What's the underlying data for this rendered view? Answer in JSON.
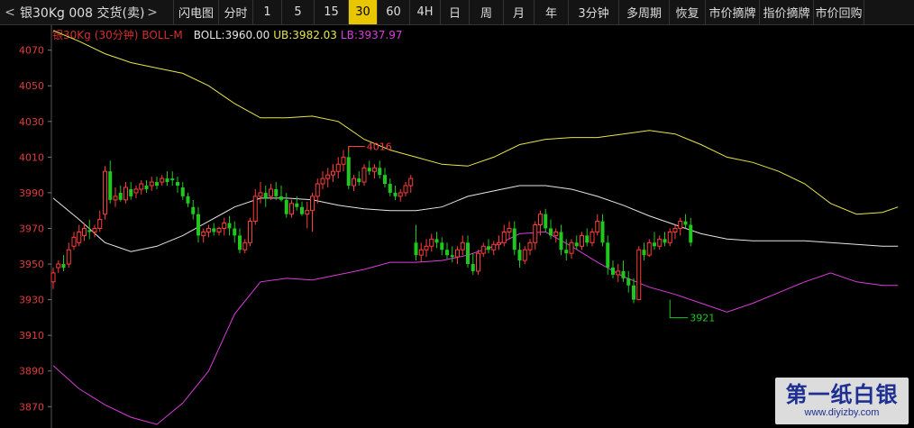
{
  "toolbar": {
    "nav_left": "<",
    "nav_right": ">",
    "title": "银30Kg 008 交货(卖)",
    "buttons": [
      {
        "label": "闪电图",
        "active": false
      },
      {
        "label": "分时",
        "active": false
      },
      {
        "label": "1",
        "active": false
      },
      {
        "label": "5",
        "active": false
      },
      {
        "label": "15",
        "active": false
      },
      {
        "label": "30",
        "active": true
      },
      {
        "label": "60",
        "active": false
      },
      {
        "label": "4H",
        "active": false
      },
      {
        "label": "日",
        "active": false
      },
      {
        "label": "周",
        "active": false
      },
      {
        "label": "月",
        "active": false
      },
      {
        "label": "年",
        "active": false
      },
      {
        "label": "3分钟",
        "active": false
      },
      {
        "label": "多周期",
        "active": false
      },
      {
        "label": "恢复",
        "active": false
      },
      {
        "label": "市价摘牌",
        "active": false
      },
      {
        "label": "指价摘牌",
        "active": false
      },
      {
        "label": "市价回购",
        "active": false
      }
    ]
  },
  "legend": {
    "instrument": "银30Kg",
    "period": "(30分钟)",
    "indicator": "BOLL-M",
    "boll": "BOLL:3960.00",
    "ub": "UB:3982.03",
    "lb": "LB:3937.97"
  },
  "colors": {
    "background": "#000000",
    "up_candle": "#ff3c3c",
    "down_candle": "#1ec81e",
    "doji": "#e6e6e6",
    "mid_band": "#e6e6e6",
    "upper_band": "#e6e64a",
    "lower_band": "#dc3cdc",
    "axis_label": "#e03c3c",
    "legend_boll": "#e6e6e6",
    "legend_ub": "#e6e64a",
    "legend_lb": "#dc3cdc",
    "legend_instrument": "#d03030",
    "accent": "#e8c700"
  },
  "watermark": {
    "name": "第一纸白银",
    "url": "www.diyizby.com"
  },
  "chart_data": {
    "type": "candlestick",
    "ylim": [
      3858,
      4084
    ],
    "yticks": [
      3870,
      3890,
      3910,
      3930,
      3950,
      3970,
      3990,
      4010,
      4030,
      4050,
      4070
    ],
    "grid": false,
    "annotations": [
      {
        "text": "4016",
        "index": 57,
        "value": 4016
      },
      {
        "text": "3921",
        "index": 119,
        "value": 3930
      }
    ],
    "ohlc": [
      [
        3940,
        3948,
        3936,
        3945
      ],
      [
        3948,
        3952,
        3945,
        3950
      ],
      [
        3950,
        3955,
        3946,
        3948
      ],
      [
        3950,
        3962,
        3948,
        3958
      ],
      [
        3960,
        3968,
        3958,
        3965
      ],
      [
        3962,
        3972,
        3960,
        3968
      ],
      [
        3966,
        3973,
        3963,
        3970
      ],
      [
        3969,
        3975,
        3964,
        3968
      ],
      [
        3968,
        3972,
        3965,
        3970
      ],
      [
        3970,
        3980,
        3968,
        3975
      ],
      [
        3978,
        4005,
        3975,
        4002
      ],
      [
        4002,
        4008,
        3984,
        3986
      ],
      [
        3986,
        3993,
        3982,
        3988
      ],
      [
        3990,
        3994,
        3985,
        3986
      ],
      [
        3986,
        3996,
        3984,
        3993
      ],
      [
        3992,
        3996,
        3986,
        3988
      ],
      [
        3990,
        3994,
        3987,
        3992
      ],
      [
        3992,
        3997,
        3989,
        3995
      ],
      [
        3994,
        3997,
        3990,
        3992
      ],
      [
        3994,
        3999,
        3991,
        3996
      ],
      [
        3996,
        3999,
        3992,
        3994
      ],
      [
        3996,
        4000,
        3994,
        3998
      ],
      [
        3998,
        4002,
        3994,
        3996
      ],
      [
        3998,
        4002,
        3994,
        3997
      ],
      [
        3996,
        3999,
        3990,
        3994
      ],
      [
        3993,
        3996,
        3986,
        3988
      ],
      [
        3988,
        3990,
        3982,
        3984
      ],
      [
        3982,
        3986,
        3975,
        3978
      ],
      [
        3978,
        3982,
        3962,
        3966
      ],
      [
        3966,
        3970,
        3962,
        3968
      ],
      [
        3968,
        3972,
        3965,
        3970
      ],
      [
        3970,
        3973,
        3966,
        3968
      ],
      [
        3968,
        3971,
        3966,
        3970
      ],
      [
        3970,
        3976,
        3966,
        3973
      ],
      [
        3973,
        3977,
        3966,
        3970
      ],
      [
        3970,
        3974,
        3962,
        3966
      ],
      [
        3966,
        3970,
        3956,
        3958
      ],
      [
        3958,
        3964,
        3956,
        3962
      ],
      [
        3962,
        3976,
        3960,
        3974
      ],
      [
        3974,
        3992,
        3972,
        3988
      ],
      [
        3988,
        3996,
        3984,
        3990
      ],
      [
        3990,
        3994,
        3982,
        3987
      ],
      [
        3988,
        3995,
        3986,
        3992
      ],
      [
        3992,
        3996,
        3986,
        3988
      ],
      [
        3988,
        3994,
        3985,
        3986
      ],
      [
        3986,
        3990,
        3976,
        3978
      ],
      [
        3978,
        3986,
        3976,
        3984
      ],
      [
        3984,
        3988,
        3980,
        3982
      ],
      [
        3982,
        3985,
        3977,
        3978
      ],
      [
        3978,
        3985,
        3970,
        3980
      ],
      [
        3980,
        3990,
        3968,
        3988
      ],
      [
        3988,
        3998,
        3984,
        3995
      ],
      [
        3995,
        4002,
        3992,
        3998
      ],
      [
        3998,
        4004,
        3993,
        4000
      ],
      [
        4000,
        4006,
        3996,
        4002
      ],
      [
        4002,
        4010,
        3998,
        4006
      ],
      [
        4006,
        4014,
        4002,
        4010
      ],
      [
        4010,
        4016,
        3992,
        3994
      ],
      [
        3994,
        4000,
        3991,
        3998
      ],
      [
        3998,
        4002,
        3994,
        3996
      ],
      [
        3996,
        4006,
        3994,
        4004
      ],
      [
        4004,
        4008,
        4000,
        4002
      ],
      [
        4002,
        4006,
        3998,
        4004
      ],
      [
        4004,
        4008,
        3998,
        4000
      ],
      [
        4000,
        4004,
        3993,
        3995
      ],
      [
        3995,
        3998,
        3988,
        3990
      ],
      [
        3990,
        3994,
        3986,
        3988
      ],
      [
        3988,
        3992,
        3985,
        3990
      ],
      [
        3990,
        3996,
        3988,
        3994
      ],
      [
        3994,
        4000,
        3990,
        3998
      ],
      [
        3962,
        3972,
        3952,
        3955
      ],
      [
        3955,
        3962,
        3951,
        3958
      ],
      [
        3958,
        3964,
        3954,
        3960
      ],
      [
        3960,
        3967,
        3957,
        3964
      ],
      [
        3964,
        3968,
        3959,
        3962
      ],
      [
        3962,
        3965,
        3955,
        3958
      ],
      [
        3958,
        3962,
        3953,
        3955
      ],
      [
        3955,
        3960,
        3951,
        3954
      ],
      [
        3954,
        3960,
        3950,
        3958
      ],
      [
        3958,
        3966,
        3955,
        3962
      ],
      [
        3962,
        3966,
        3948,
        3950
      ],
      [
        3950,
        3956,
        3944,
        3946
      ],
      [
        3946,
        3958,
        3944,
        3956
      ],
      [
        3956,
        3962,
        3954,
        3960
      ],
      [
        3960,
        3964,
        3956,
        3958
      ],
      [
        3958,
        3963,
        3955,
        3961
      ],
      [
        3961,
        3966,
        3958,
        3962
      ],
      [
        3962,
        3972,
        3960,
        3968
      ],
      [
        3968,
        3974,
        3964,
        3970
      ],
      [
        3970,
        3974,
        3955,
        3958
      ],
      [
        3958,
        3962,
        3948,
        3952
      ],
      [
        3952,
        3960,
        3950,
        3958
      ],
      [
        3958,
        3964,
        3955,
        3962
      ],
      [
        3962,
        3974,
        3958,
        3972
      ],
      [
        3972,
        3980,
        3966,
        3978
      ],
      [
        3978,
        3981,
        3968,
        3970
      ],
      [
        3970,
        3975,
        3964,
        3966
      ],
      [
        3966,
        3970,
        3962,
        3968
      ],
      [
        3968,
        3972,
        3955,
        3958
      ],
      [
        3958,
        3964,
        3952,
        3956
      ],
      [
        3956,
        3964,
        3953,
        3962
      ],
      [
        3962,
        3966,
        3958,
        3960
      ],
      [
        3960,
        3968,
        3958,
        3966
      ],
      [
        3966,
        3970,
        3960,
        3962
      ],
      [
        3962,
        3970,
        3960,
        3968
      ],
      [
        3968,
        3978,
        3966,
        3974
      ],
      [
        3974,
        3978,
        3960,
        3962
      ],
      [
        3962,
        3966,
        3944,
        3948
      ],
      [
        3948,
        3952,
        3942,
        3944
      ],
      [
        3944,
        3950,
        3940,
        3946
      ],
      [
        3946,
        3952,
        3940,
        3942
      ],
      [
        3942,
        3946,
        3934,
        3938
      ],
      [
        3938,
        3942,
        3928,
        3930
      ],
      [
        3930,
        3960,
        3930,
        3958
      ],
      [
        3958,
        3962,
        3952,
        3955
      ],
      [
        3955,
        3964,
        3954,
        3962
      ],
      [
        3962,
        3968,
        3958,
        3960
      ],
      [
        3960,
        3966,
        3958,
        3964
      ],
      [
        3964,
        3968,
        3960,
        3962
      ],
      [
        3962,
        3970,
        3960,
        3968
      ],
      [
        3968,
        3972,
        3964,
        3970
      ],
      [
        3970,
        3976,
        3966,
        3974
      ],
      [
        3974,
        3978,
        3970,
        3972
      ],
      [
        3972,
        3976,
        3960,
        3962
      ]
    ],
    "mid_band": [
      [
        0,
        3987
      ],
      [
        5,
        3975
      ],
      [
        10,
        3962
      ],
      [
        15,
        3957
      ],
      [
        20,
        3960
      ],
      [
        25,
        3966
      ],
      [
        30,
        3974
      ],
      [
        35,
        3982
      ],
      [
        40,
        3987
      ],
      [
        45,
        3987
      ],
      [
        50,
        3986
      ],
      [
        55,
        3983
      ],
      [
        60,
        3981
      ],
      [
        65,
        3980
      ],
      [
        70,
        3980
      ],
      [
        75,
        3982
      ],
      [
        80,
        3988
      ],
      [
        85,
        3991
      ],
      [
        90,
        3994
      ],
      [
        95,
        3994
      ],
      [
        100,
        3992
      ],
      [
        105,
        3988
      ],
      [
        110,
        3983
      ],
      [
        115,
        3977
      ],
      [
        120,
        3972
      ],
      [
        125,
        3967
      ],
      [
        130,
        3964
      ],
      [
        135,
        3963
      ],
      [
        140,
        3963
      ],
      [
        145,
        3963
      ],
      [
        150,
        3962
      ],
      [
        155,
        3961
      ],
      [
        160,
        3960
      ],
      [
        163,
        3960
      ]
    ],
    "upper_band": [
      [
        0,
        4081
      ],
      [
        5,
        4075
      ],
      [
        10,
        4068
      ],
      [
        15,
        4063
      ],
      [
        20,
        4060
      ],
      [
        25,
        4057
      ],
      [
        30,
        4050
      ],
      [
        35,
        4040
      ],
      [
        40,
        4032
      ],
      [
        45,
        4032
      ],
      [
        50,
        4033
      ],
      [
        55,
        4030
      ],
      [
        60,
        4020
      ],
      [
        65,
        4014
      ],
      [
        70,
        4010
      ],
      [
        75,
        4006
      ],
      [
        80,
        4005
      ],
      [
        85,
        4010
      ],
      [
        90,
        4017
      ],
      [
        95,
        4020
      ],
      [
        100,
        4021
      ],
      [
        105,
        4021
      ],
      [
        110,
        4023
      ],
      [
        115,
        4025
      ],
      [
        120,
        4023
      ],
      [
        125,
        4017
      ],
      [
        130,
        4010
      ],
      [
        135,
        4007
      ],
      [
        140,
        4002
      ],
      [
        145,
        3995
      ],
      [
        150,
        3984
      ],
      [
        155,
        3978
      ],
      [
        160,
        3979
      ],
      [
        163,
        3982
      ]
    ],
    "lower_band": [
      [
        0,
        3893
      ],
      [
        5,
        3880
      ],
      [
        10,
        3871
      ],
      [
        15,
        3864
      ],
      [
        20,
        3860
      ],
      [
        25,
        3872
      ],
      [
        30,
        3890
      ],
      [
        35,
        3922
      ],
      [
        40,
        3940
      ],
      [
        45,
        3942
      ],
      [
        50,
        3941
      ],
      [
        55,
        3944
      ],
      [
        60,
        3947
      ],
      [
        65,
        3951
      ],
      [
        70,
        3951
      ],
      [
        75,
        3952
      ],
      [
        80,
        3955
      ],
      [
        85,
        3960
      ],
      [
        90,
        3967
      ],
      [
        95,
        3968
      ],
      [
        100,
        3960
      ],
      [
        105,
        3951
      ],
      [
        110,
        3943
      ],
      [
        115,
        3937
      ],
      [
        120,
        3933
      ],
      [
        125,
        3928
      ],
      [
        130,
        3923
      ],
      [
        135,
        3928
      ],
      [
        140,
        3934
      ],
      [
        145,
        3940
      ],
      [
        150,
        3945
      ],
      [
        155,
        3940
      ],
      [
        160,
        3938
      ],
      [
        163,
        3938
      ]
    ]
  }
}
